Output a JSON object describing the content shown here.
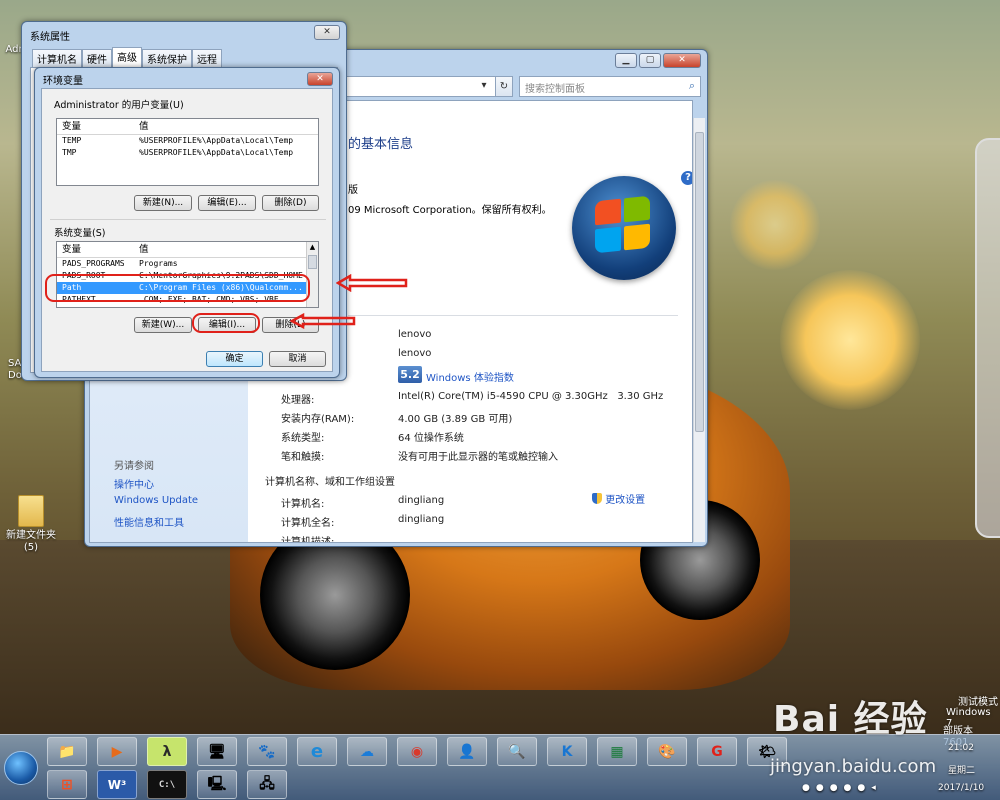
{
  "desktop": {
    "icons": [
      {
        "label": "Adr"
      },
      {
        "label": "SAP B Documen..."
      },
      {
        "label": "新建文件夹 (5)"
      }
    ],
    "watermark_test": "测试模式",
    "watermark_os": "Windows 7",
    "watermark_build": "部版本 7601",
    "baidu_logo": "Bai 经验",
    "baidu_url": "jingyan.baidu.com"
  },
  "control_panel": {
    "search_placeholder": "搜索控制面板",
    "heading": "的基本信息",
    "edition": "版",
    "copyright": "09 Microsoft Corporation。保留所有权利。",
    "see_also_title": "另请参阅",
    "see_also": [
      "操作中心",
      "Windows Update",
      "性能信息和工具"
    ],
    "rows_top": [
      {
        "label": "",
        "value": "lenovo"
      },
      {
        "label": "",
        "value": "lenovo"
      }
    ],
    "rating_score": "5.2",
    "rating_link": "Windows 体验指数",
    "system_rows": [
      {
        "label": "处理器:",
        "value": "Intel(R) Core(TM) i5-4590 CPU @ 3.30GHz   3.30 GHz"
      },
      {
        "label": "安装内存(RAM):",
        "value": "4.00 GB (3.89 GB 可用)"
      },
      {
        "label": "系统类型:",
        "value": "64 位操作系统"
      },
      {
        "label": "笔和触摸:",
        "value": "没有可用于此显示器的笔或触控输入"
      }
    ],
    "computer_section_title": "计算机名称、域和工作组设置",
    "computer_rows": [
      {
        "label": "计算机名:",
        "value": "dingliang"
      },
      {
        "label": "计算机全名:",
        "value": "dingliang"
      },
      {
        "label": "计算机描述:",
        "value": ""
      }
    ],
    "change_settings": "更改设置"
  },
  "system_properties": {
    "title": "系统属性",
    "tabs": [
      "计算机名",
      "硬件",
      "高级",
      "系统保护",
      "远程"
    ],
    "active_tab": 2
  },
  "env_dialog": {
    "title": "环境变量",
    "user_group": "Administrator 的用户变量(U)",
    "col_var": "变量",
    "col_val": "值",
    "user_vars": [
      {
        "name": "TEMP",
        "value": "%USERPROFILE%\\AppData\\Local\\Temp"
      },
      {
        "name": "TMP",
        "value": "%USERPROFILE%\\AppData\\Local\\Temp"
      }
    ],
    "user_buttons": [
      "新建(N)...",
      "编辑(E)...",
      "删除(D)"
    ],
    "sys_group": "系统变量(S)",
    "sys_vars": [
      {
        "name": "PADS_PROGRAMS",
        "value": "Programs"
      },
      {
        "name": "PADS_ROOT",
        "value": "C:\\MentorGraphics\\9.2PADS\\SDD_HOME"
      },
      {
        "name": "Path",
        "value": "C:\\Program Files (x86)\\Qualcomm..."
      },
      {
        "name": "PATHEXT",
        "value": ".COM;.EXE;.BAT;.CMD;.VBS;.VBE"
      }
    ],
    "selected_index": 2,
    "sys_buttons": [
      "新建(W)...",
      "编辑(I)...",
      "删除(L)"
    ],
    "ok": "确定",
    "cancel": "取消"
  },
  "taskbar": {
    "apps_top": [
      "📁",
      "▶",
      "λ",
      "🖥",
      "🐾",
      "e",
      "☁",
      "◉",
      "👤",
      "🔍",
      "K",
      "▦",
      "🎨",
      "G",
      "🌤"
    ],
    "apps_bottom": [
      "⊞",
      "W³",
      "C:\\",
      "🖳",
      "🖧"
    ],
    "time": "21:02",
    "weekday": "星期二",
    "date": "2017/1/10"
  }
}
